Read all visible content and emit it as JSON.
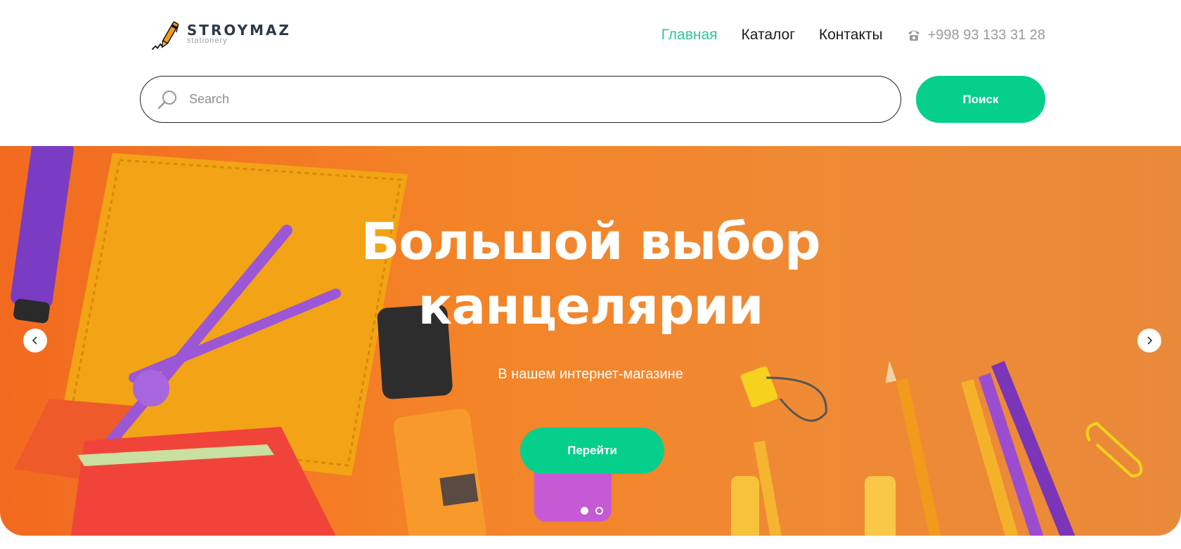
{
  "logo": {
    "title": "STROYMAZ",
    "subtitle": "stationery",
    "icon": "pen-icon"
  },
  "nav": {
    "items": [
      {
        "label": "Главная",
        "active": true
      },
      {
        "label": "Каталог",
        "active": false
      },
      {
        "label": "Контакты",
        "active": false
      }
    ],
    "phone": "+998 93 133 31 28",
    "phone_icon": "phone-icon"
  },
  "search": {
    "placeholder": "Search",
    "value": "",
    "button_label": "Поиск",
    "icon": "search-icon"
  },
  "hero": {
    "title_line1": "Большой выбор",
    "title_line2": "канцелярии",
    "subtitle": "В нашем интернет-магазине",
    "button_label": "Перейти",
    "prev_icon": "chevron-left-icon",
    "next_icon": "chevron-right-icon",
    "slides_count": 2,
    "active_slide": 1
  },
  "colors": {
    "accent": "#06cf8c",
    "nav_active": "#2fc59a",
    "hero_orange": "#f48428",
    "text_dark": "#1b1b1b"
  }
}
